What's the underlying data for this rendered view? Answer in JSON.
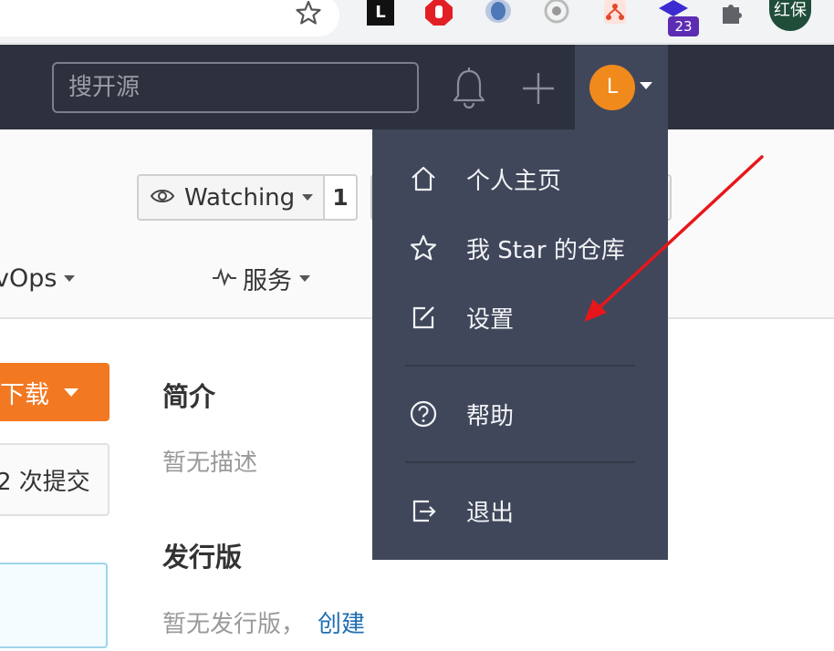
{
  "browser": {
    "extension_badge_count": "23",
    "profile_label": "红保",
    "ext_l_letter": "L"
  },
  "header": {
    "search_placeholder": "搜开源",
    "avatar_initial": "L"
  },
  "repo": {
    "watch_label": "Watching",
    "watch_count": "1",
    "tab_devops": "vOps",
    "tab_service": "服务"
  },
  "main": {
    "download_label": "下载",
    "commits_label": "2 次提交",
    "intro_title": "简介",
    "intro_text": "暂无描述",
    "release_title": "发行版",
    "release_text": "暂无发行版，",
    "release_create": "创建"
  },
  "user_menu": {
    "items": [
      {
        "label": "个人主页",
        "icon": "home-icon"
      },
      {
        "label": "我 Star 的仓库",
        "icon": "star-outline-icon"
      },
      {
        "label": "设置",
        "icon": "edit-icon"
      },
      {
        "label": "帮助",
        "icon": "help-circle-icon"
      },
      {
        "label": "退出",
        "icon": "logout-icon"
      }
    ]
  },
  "colors": {
    "header_bg": "#2d313e",
    "menu_bg": "#40475a",
    "accent_orange": "#f27822",
    "avatar_orange": "#f08a1c",
    "annotation_red": "#e8161b",
    "link_blue": "#1f6fb2"
  }
}
